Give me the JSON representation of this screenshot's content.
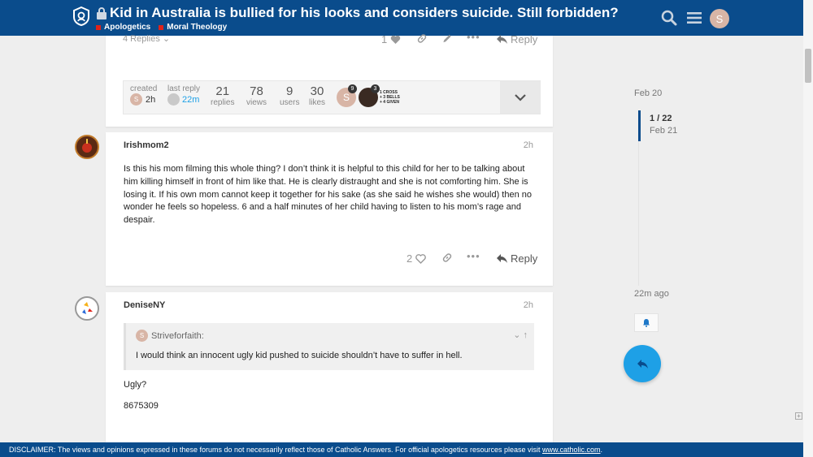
{
  "header": {
    "topic_title": "Kid in Australia is bullied for his looks and considers suicide. Still forbidden?",
    "categories": [
      "Apologetics",
      "Moral Theology"
    ],
    "user_initial": "S",
    "accent": "#0a4c8c",
    "category_color": "#e0231a"
  },
  "post1": {
    "replies_link": "4 Replies",
    "like_count": "1",
    "reply_label": "Reply",
    "summary": {
      "created_label": "created",
      "created_value": "2h",
      "created_avatar": "S",
      "last_reply_label": "last reply",
      "last_reply_value": "22m",
      "stats": [
        {
          "num": "21",
          "label": "replies"
        },
        {
          "num": "78",
          "label": "views"
        },
        {
          "num": "9",
          "label": "users"
        },
        {
          "num": "30",
          "label": "likes"
        }
      ],
      "participant_initial": "S",
      "badges": [
        "9",
        "3"
      ],
      "badge_text": [
        "1 CROSS",
        "+ 3 BELLS",
        "+ 4 GIVEN"
      ]
    }
  },
  "post2": {
    "username": "Irishmom2",
    "age": "2h",
    "body": "Is this his mom filming this whole thing? I don’t think it is helpful to this child for her to be talking about him killing himself in front of him like that. He is clearly distraught and she is not comforting him. She is losing it. If his own mom cannot keep it together for his sake (as she said he wishes she would) then no wonder he feels so hopeless. 6 and a half minutes of her child having to listen to his mom’s rage and despair.",
    "like_count": "2",
    "reply_label": "Reply"
  },
  "post3": {
    "username": "DeniseNY",
    "age": "2h",
    "quote_author": "Striveforfaith:",
    "quote_avatar": "S",
    "quote_text": "I would think an innocent ugly kid pushed to suicide shouldn’t have to suffer in hell.",
    "line1": "Ugly?",
    "line2": "8675309"
  },
  "timeline": {
    "start_date": "Feb 20",
    "position": "1 / 22",
    "position_date": "Feb 21",
    "last_activity": "22m ago"
  },
  "footer": {
    "disclaimer": "DISCLAIMER: The views and opinions expressed in these forums do not necessarily reflect those of Catholic Answers. For official apologetics resources please visit",
    "link": "www.catholic.com",
    "end": "."
  }
}
